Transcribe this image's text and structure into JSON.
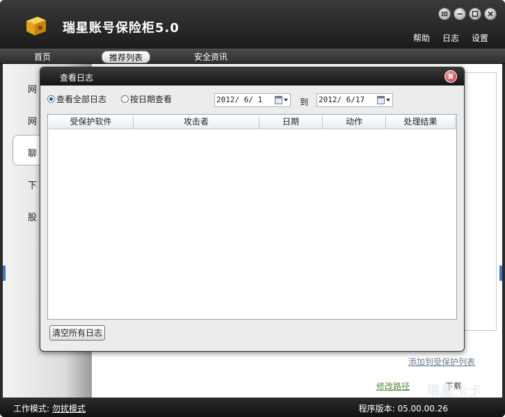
{
  "app": {
    "title": "瑞星账号保险柜5.0",
    "top_links": [
      "帮助",
      "日志",
      "设置"
    ],
    "window_buttons": [
      "restore-icon",
      "minimize-icon",
      "maximize-icon",
      "close-icon"
    ]
  },
  "nav": {
    "tabs": [
      {
        "label": "首页",
        "active": false
      },
      {
        "label": "推荐列表",
        "active": true
      },
      {
        "label": "安全资讯",
        "active": false
      }
    ]
  },
  "sidebar": {
    "items": [
      {
        "label": "网"
      },
      {
        "label": "网"
      },
      {
        "label": "聊"
      },
      {
        "label": "下"
      },
      {
        "label": "股"
      }
    ]
  },
  "content": {
    "link_add": "添加到受保护列表",
    "link_path": "修改路径",
    "link_download": "下载"
  },
  "watermark": {
    "text": "瑞星卡卡",
    "url": "ikaka.com"
  },
  "status": {
    "mode_label": "工作模式:",
    "mode_value": "勿扰模式",
    "version_label": "程序版本: 05.00.00.26"
  },
  "dialog": {
    "title": "查看日志",
    "radio_all": "查看全部日志",
    "radio_by_date": "按日期查看",
    "radio_selected": "all",
    "date_from": "2012/ 6/ 1",
    "to_label": "到",
    "date_to": "2012/ 6/17",
    "columns": [
      "受保护软件",
      "攻击者",
      "日期",
      "动作",
      "处理结果"
    ],
    "rows": [],
    "clear_button": "清空所有日志"
  },
  "colors": {
    "title_bar": "#1b1b1b",
    "dialog_close": "#c4262e",
    "link_green": "#5a8a3a",
    "accent_blue": "#3a78c8"
  }
}
